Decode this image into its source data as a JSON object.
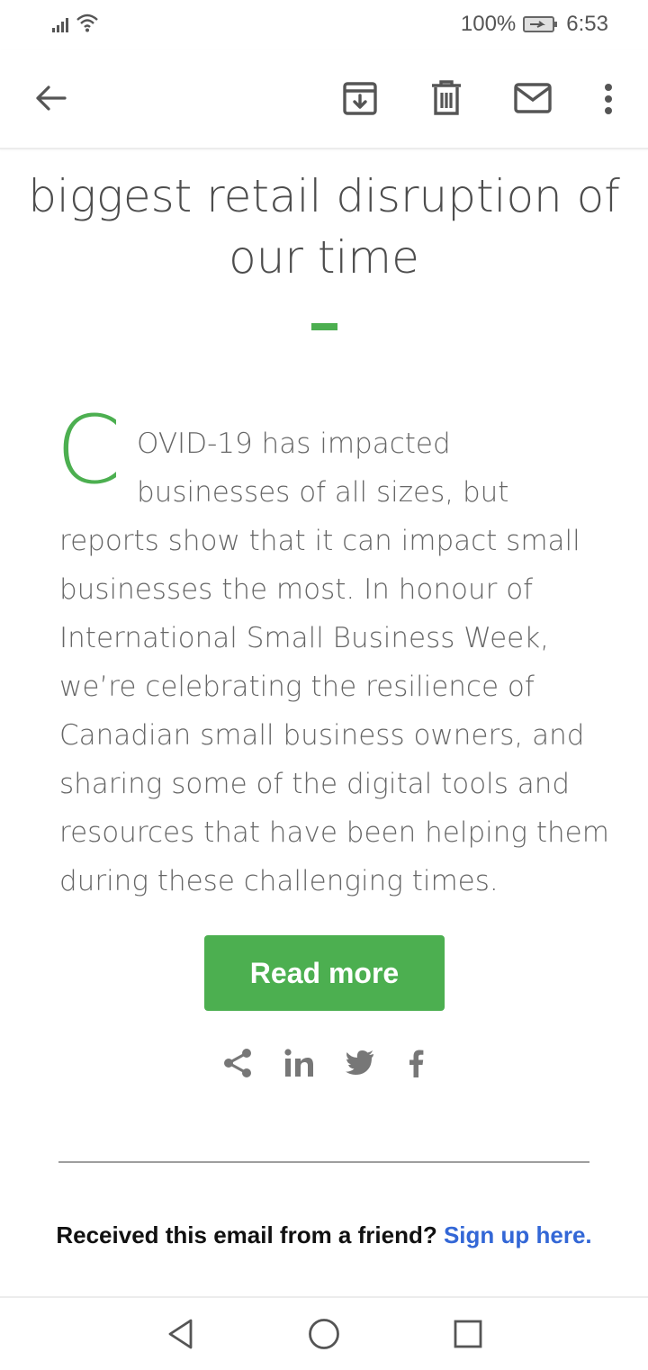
{
  "status": {
    "battery": "100%",
    "time": "6:53"
  },
  "toolbar": {
    "back_icon": "arrow-left-icon",
    "archive_icon": "archive-icon",
    "delete_icon": "trash-icon",
    "unread_icon": "mail-icon",
    "more_icon": "more-vert-icon"
  },
  "article": {
    "headline_lines": [
      "biggest retail disruption of",
      "our time"
    ],
    "dropcap": "C",
    "body_lines": [
      "OVID-19 has impacted",
      "businesses of all sizes, but",
      "reports show that it can impact small",
      "businesses the most. In honour of",
      "International Small Business Week,",
      "we’re celebrating the resilience of",
      "Canadian small business owners, and",
      "sharing some of the digital tools and",
      "resources that have been helping them",
      "during these challenging times."
    ],
    "cta_label": "Read more"
  },
  "social": [
    "share-icon",
    "linkedin-icon",
    "twitter-icon",
    "facebook-icon"
  ],
  "footer": {
    "prompt": "Received this email from a friend? ",
    "link": "Sign up here."
  },
  "colors": {
    "accent": "#4caf50",
    "link": "#3367d6",
    "text": "#666666"
  }
}
